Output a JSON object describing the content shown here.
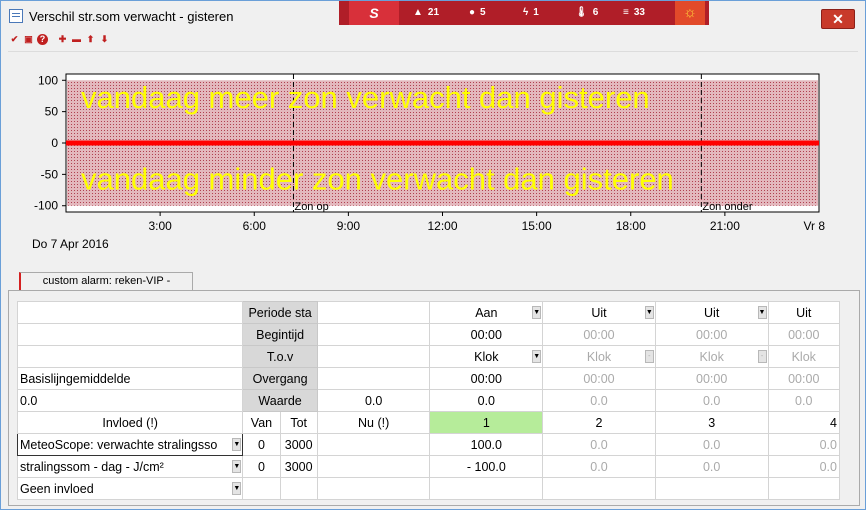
{
  "window": {
    "title": "Verschil str.som verwacht - gisteren"
  },
  "statusbar": {
    "logo": "S",
    "items": [
      {
        "icon": "warning-icon",
        "glyph": "▲",
        "value": "21"
      },
      {
        "icon": "drop-icon",
        "glyph": "●",
        "value": "5"
      },
      {
        "icon": "lightning-icon",
        "glyph": "ϟ",
        "value": "1"
      },
      {
        "icon": "thermometer-icon",
        "glyph": "🌡",
        "value": "6"
      },
      {
        "icon": "list-icon",
        "glyph": "≡",
        "value": "33"
      }
    ],
    "sun_glyph": "☼"
  },
  "toolbar": {
    "icons": [
      "check-icon",
      "print-icon",
      "help-icon",
      "add-icon",
      "remove-icon",
      "move-up-icon",
      "move-down-icon"
    ]
  },
  "chart_data": {
    "type": "line",
    "ylim": [
      -110,
      110
    ],
    "yticks": [
      "100",
      "50",
      "0",
      "-50",
      "-100"
    ],
    "xticks": [
      "3:00",
      "6:00",
      "9:00",
      "12:00",
      "15:00",
      "18:00",
      "21:00"
    ],
    "date_left": "Do  7 Apr 2016",
    "date_right": "Vr  8",
    "sunrise_label": "Zon op",
    "sunset_label": "Zon onder",
    "sunrise_time": "7:15",
    "sunset_time": "20:15",
    "series": [
      {
        "x": [
          "0:00",
          "24:00"
        ],
        "y": [
          0,
          0
        ],
        "color": "#ff0000"
      }
    ],
    "annotation_top": "vandaag meer zon verwacht dan gisteren",
    "annotation_bottom": "vandaag minder zon verwacht dan gisteren",
    "band_color": "#d9a0a8",
    "text_color": "#ffff00"
  },
  "tab": {
    "label": "custom alarm: reken-VIP -"
  },
  "table": {
    "rows_left": [
      "",
      "",
      "",
      "Basislijngemiddelde",
      "0.0"
    ],
    "labels": [
      "Periode sta",
      "Begintijd",
      "T.o.v",
      "Overgang",
      "Waarde"
    ],
    "extra_waarde": "0.0",
    "periods": [
      {
        "state": "Aan",
        "begin": "00:00",
        "tov": "Klok",
        "overgang": "00:00",
        "waarde": "0.0"
      },
      {
        "state": "Uit",
        "begin": "00:00",
        "tov": "Klok",
        "overgang": "00:00",
        "waarde": "0.0"
      },
      {
        "state": "Uit",
        "begin": "00:00",
        "tov": "Klok",
        "overgang": "00:00",
        "waarde": "0.0"
      },
      {
        "state": "Uit",
        "begin": "00:00",
        "tov": "Klok",
        "overgang": "00:00",
        "waarde": "0.0"
      }
    ],
    "header": {
      "invloed": "Invloed (!)",
      "van": "Van",
      "tot": "Tot",
      "nu": "Nu (!)",
      "p1": "1",
      "p2": "2",
      "p3": "3",
      "p4": "4"
    },
    "inputs": [
      {
        "name": "MeteoScope: verwachte stralingsso",
        "van": "0",
        "tot": "3000",
        "v1": "100.0",
        "v2": "0.0",
        "v3": "0.0",
        "v4": "0.0"
      },
      {
        "name": "stralingssom - dag - J/cm²",
        "van": "0",
        "tot": "3000",
        "v1": "- 100.0",
        "v2": "0.0",
        "v3": "0.0",
        "v4": "0.0"
      },
      {
        "name": "Geen invloed",
        "van": "",
        "tot": "",
        "v1": "",
        "v2": "",
        "v3": "",
        "v4": ""
      }
    ]
  }
}
